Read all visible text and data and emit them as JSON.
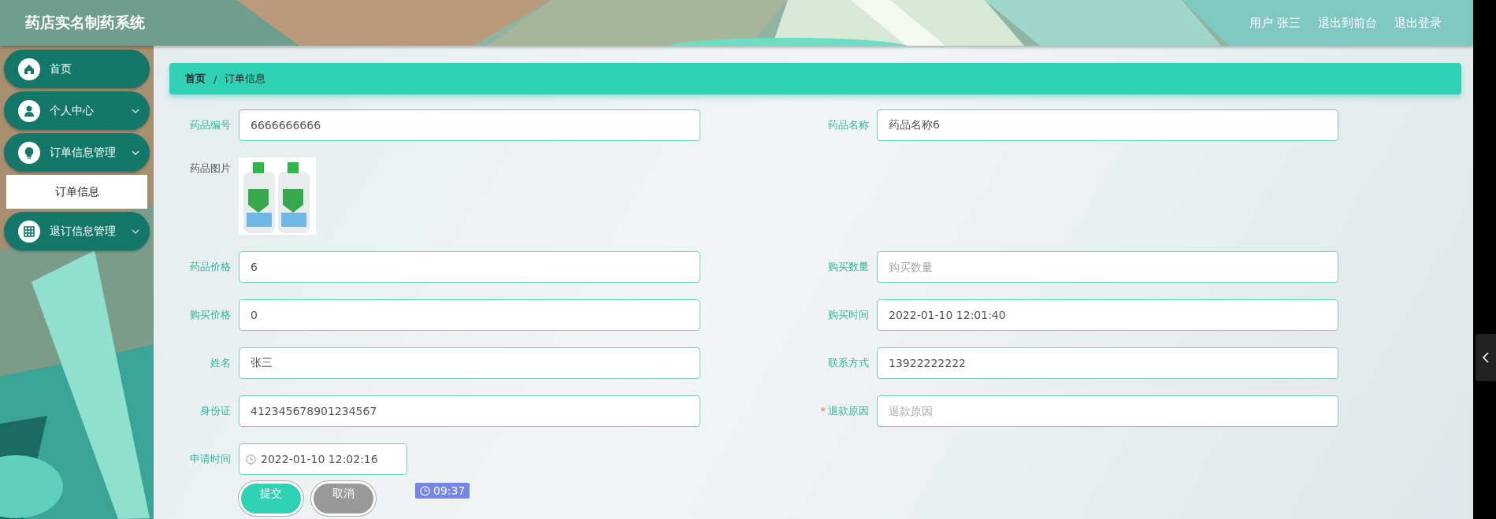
{
  "header": {
    "title": "药店实名制药系统",
    "links": [
      "用户 张三",
      "退出到前台",
      "退出登录"
    ]
  },
  "sidebar": {
    "items": [
      {
        "label": "首页"
      },
      {
        "label": "个人中心",
        "expanded": false
      },
      {
        "label": "订单信息管理",
        "expanded": true,
        "children": [
          {
            "label": "订单信息",
            "selected": true
          }
        ]
      },
      {
        "label": "退订信息管理",
        "expanded": false
      }
    ]
  },
  "breadcrumb": {
    "items": [
      "首页",
      "订单信息"
    ],
    "separator": "/"
  },
  "form": {
    "rows": [
      [
        {
          "kind": "input",
          "label": "药品编号",
          "value": "6666666666"
        },
        {
          "kind": "input",
          "label": "药品名称",
          "value": "药品名称6"
        }
      ],
      [
        {
          "label": "药品图片"
        }
      ],
      [
        {
          "kind": "input",
          "label": "药品价格",
          "value": "6"
        },
        {
          "kind": "input",
          "label": "购买数量",
          "placeholder": "购买数量"
        }
      ],
      [
        {
          "kind": "input",
          "label": "购买价格",
          "value": "0"
        },
        {
          "kind": "input",
          "label": "购买时间",
          "value": "2022-01-10 12:01:40"
        }
      ],
      [
        {
          "kind": "input",
          "label": "姓名",
          "value": "张三"
        },
        {
          "kind": "input",
          "label": "联系方式",
          "value": "13922222222"
        }
      ],
      [
        {
          "kind": "input",
          "label": "身份证",
          "value": "412345678901234567"
        },
        {
          "kind": "input",
          "label": "退款原因",
          "placeholder": "退款原因",
          "mark": "*"
        }
      ],
      [
        {
          "kind": "date",
          "label": "申请时间",
          "value": "2022-01-10 12:02:16"
        }
      ]
    ],
    "buttons": [
      {
        "label": "提交",
        "kind": "primary"
      },
      {
        "label": "取消",
        "kind": "cancel"
      }
    ]
  },
  "time_badge": "09:37"
}
